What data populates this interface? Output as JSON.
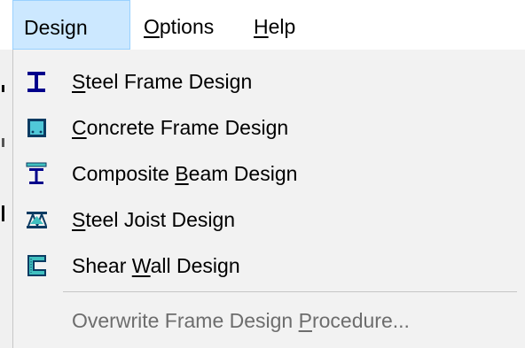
{
  "menubar": {
    "items": [
      {
        "pre": "Desi",
        "ul": "g",
        "post": "n",
        "active": true
      },
      {
        "pre": "",
        "ul": "O",
        "post": "ptions",
        "active": false
      },
      {
        "pre": "",
        "ul": "H",
        "post": "elp",
        "active": false
      }
    ]
  },
  "dropdown": {
    "items": [
      {
        "icon": "steel-i-beam-icon",
        "pre": "",
        "ul": "S",
        "post": "teel Frame Design",
        "enabled": true
      },
      {
        "icon": "concrete-section-icon",
        "pre": "",
        "ul": "C",
        "post": "oncrete Frame Design",
        "enabled": true
      },
      {
        "icon": "composite-beam-icon",
        "pre": "Composite ",
        "ul": "B",
        "post": "eam Design",
        "enabled": true
      },
      {
        "icon": "steel-joist-icon",
        "pre": "",
        "ul": "S",
        "post": "teel Joist Design",
        "enabled": true
      },
      {
        "icon": "shear-wall-icon",
        "pre": "Shear ",
        "ul": "W",
        "post": "all Design",
        "enabled": true
      },
      {
        "icon": "none",
        "pre": "Overwrite Frame Design ",
        "ul": "P",
        "post": "rocedure...",
        "enabled": false
      }
    ]
  },
  "colors": {
    "menubar_bg": "#ffffff",
    "active_highlight": "#cce8ff",
    "active_border": "#99d1ff",
    "dropdown_bg": "#f2f2f2",
    "disabled_text": "#6d6d6d",
    "icon_blue": "#00008b",
    "icon_cyan": "#40c0c0"
  }
}
